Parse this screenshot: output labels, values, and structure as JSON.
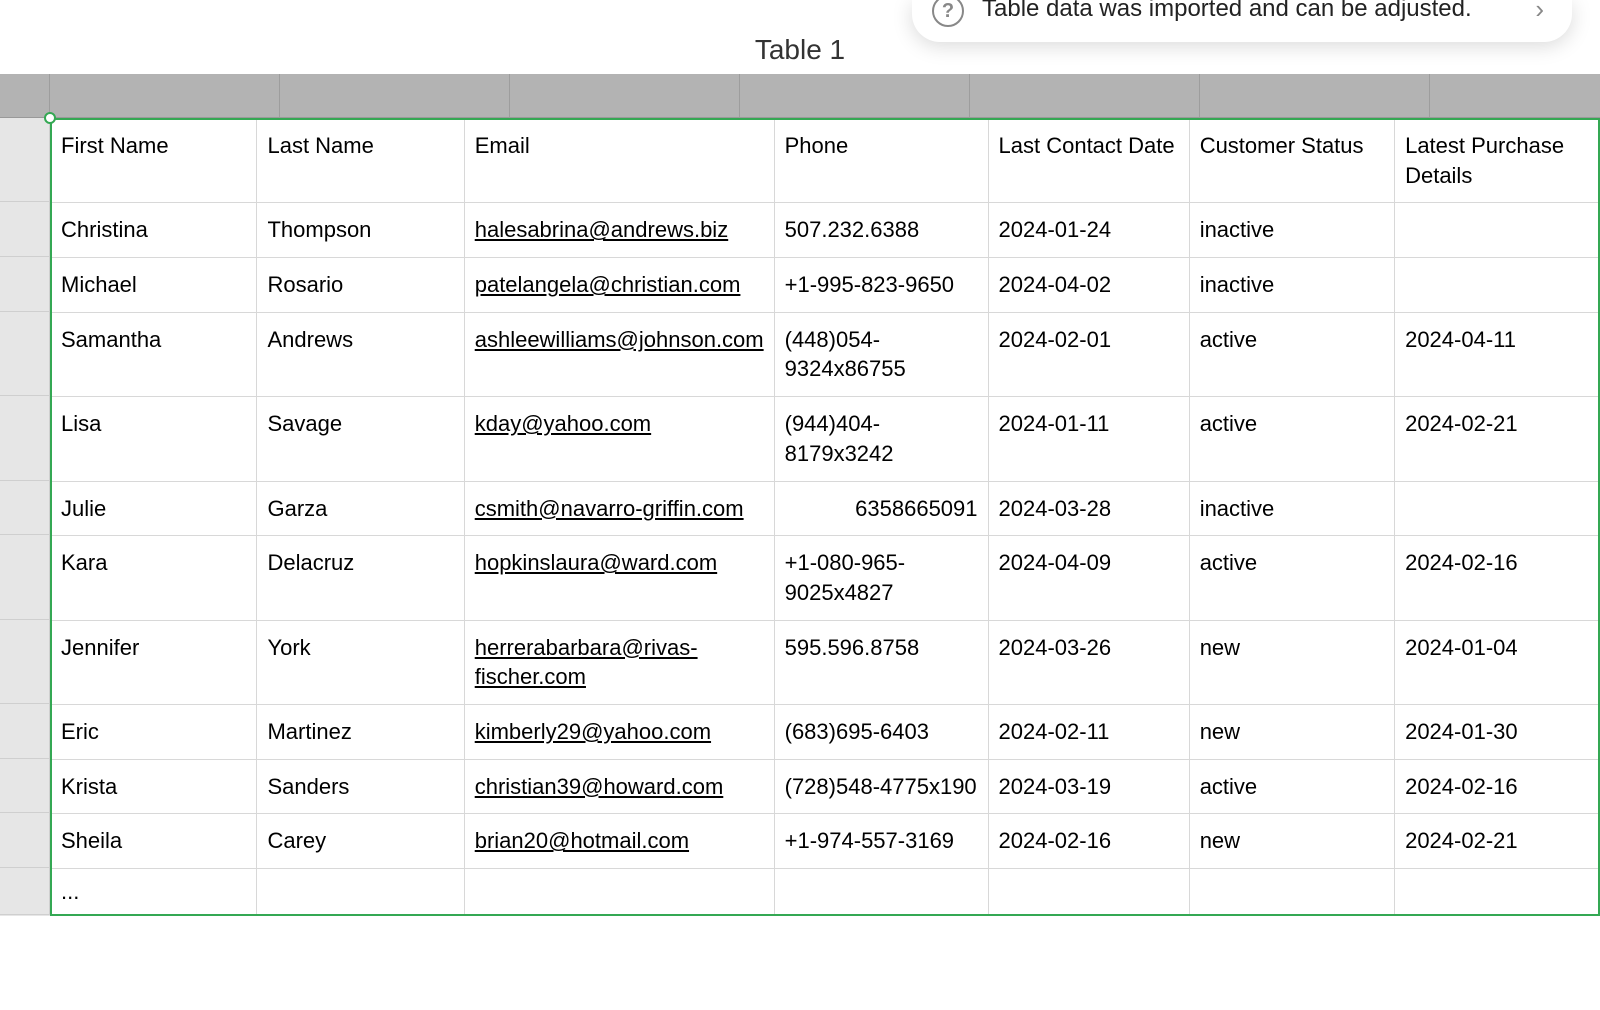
{
  "title": "Table 1",
  "notification": {
    "help": "?",
    "message": "Table data was imported and can be adjusted.",
    "chevron": "›"
  },
  "headers": {
    "first_name": "First Name",
    "last_name": "Last Name",
    "email": "Email",
    "phone": "Phone",
    "last_contact": "Last Contact Date",
    "status": "Customer Status",
    "latest_purchase": "Latest Purchase Details"
  },
  "rows": [
    {
      "first_name": "Christina",
      "last_name": "Thompson",
      "email": "halesabrina@andrews.biz",
      "phone": "507.232.6388",
      "last_contact": "2024-01-24",
      "status": "inactive",
      "latest_purchase": ""
    },
    {
      "first_name": "Michael",
      "last_name": "Rosario",
      "email": "patelangela@christian.com",
      "phone": "+1-995-823-9650",
      "last_contact": "2024-04-02",
      "status": "inactive",
      "latest_purchase": ""
    },
    {
      "first_name": "Samantha",
      "last_name": "Andrews",
      "email": "ashleewilliams@johnson.com",
      "phone": "(448)054-9324x86755",
      "last_contact": "2024-02-01",
      "status": "active",
      "latest_purchase": "2024-04-11"
    },
    {
      "first_name": "Lisa",
      "last_name": "Savage",
      "email": "kday@yahoo.com",
      "phone": "(944)404-8179x3242",
      "last_contact": "2024-01-11",
      "status": "active",
      "latest_purchase": "2024-02-21"
    },
    {
      "first_name": "Julie",
      "last_name": "Garza",
      "email": "csmith@navarro-griffin.com",
      "phone": "6358665091",
      "phone_right": true,
      "last_contact": "2024-03-28",
      "status": "inactive",
      "latest_purchase": ""
    },
    {
      "first_name": "Kara",
      "last_name": "Delacruz",
      "email": "hopkinslaura@ward.com",
      "phone": "+1-080-965-9025x4827",
      "last_contact": "2024-04-09",
      "status": "active",
      "latest_purchase": "2024-02-16"
    },
    {
      "first_name": "Jennifer",
      "last_name": "York",
      "email": "herrerabarbara@rivas-fischer.com",
      "phone": "595.596.8758",
      "last_contact": "2024-03-26",
      "status": "new",
      "latest_purchase": "2024-01-04"
    },
    {
      "first_name": "Eric",
      "last_name": "Martinez",
      "email": "kimberly29@yahoo.com",
      "phone": "(683)695-6403",
      "last_contact": "2024-02-11",
      "status": "new",
      "latest_purchase": "2024-01-30"
    },
    {
      "first_name": "Krista",
      "last_name": "Sanders",
      "email": "christian39@howard.com",
      "phone": "(728)548-4775x190",
      "last_contact": "2024-03-19",
      "status": "active",
      "latest_purchase": "2024-02-16"
    },
    {
      "first_name": "Sheila",
      "last_name": "Carey",
      "email": "brian20@hotmail.com",
      "phone": "+1-974-557-3169",
      "last_contact": "2024-02-16",
      "status": "new",
      "latest_purchase": "2024-02-21"
    }
  ],
  "ellipsis": "..."
}
